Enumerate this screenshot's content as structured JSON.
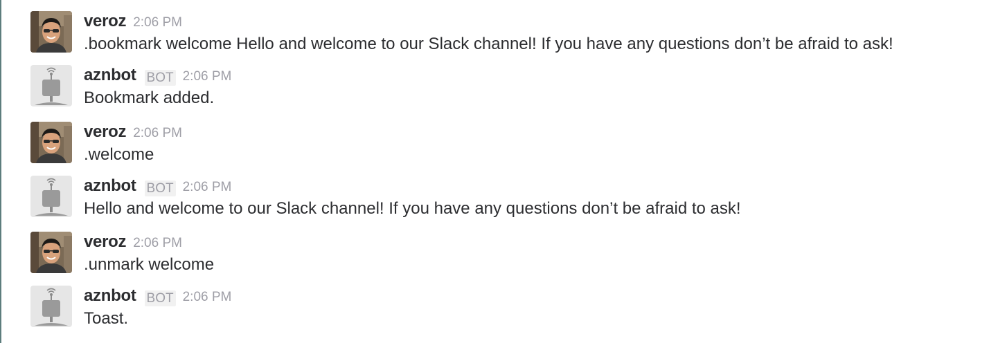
{
  "channel": {
    "messages": [
      {
        "user": "veroz",
        "is_bot": false,
        "bot_label": "",
        "avatar": "user-photo-avatar",
        "time": "2:06 PM",
        "text": ".bookmark welcome Hello and welcome to our Slack channel! If you have any questions don’t be afraid to ask!"
      },
      {
        "user": "aznbot",
        "is_bot": true,
        "bot_label": "BOT",
        "avatar": "robot-icon",
        "time": "2:06 PM",
        "text": "Bookmark added."
      },
      {
        "user": "veroz",
        "is_bot": false,
        "bot_label": "",
        "avatar": "user-photo-avatar",
        "time": "2:06 PM",
        "text": ".welcome"
      },
      {
        "user": "aznbot",
        "is_bot": true,
        "bot_label": "BOT",
        "avatar": "robot-icon",
        "time": "2:06 PM",
        "text": "Hello and welcome to our Slack channel! If you have any questions don’t be afraid to ask!"
      },
      {
        "user": "veroz",
        "is_bot": false,
        "bot_label": "",
        "avatar": "user-photo-avatar",
        "time": "2:06 PM",
        "text": ".unmark welcome"
      },
      {
        "user": "aznbot",
        "is_bot": true,
        "bot_label": "BOT",
        "avatar": "robot-icon",
        "time": "2:06 PM",
        "text": "Toast."
      }
    ]
  },
  "colors": {
    "text": "#2c2d30",
    "muted": "#9e9ea6",
    "badge_bg": "#f1f1f1",
    "left_border": "#5d7d7d"
  }
}
